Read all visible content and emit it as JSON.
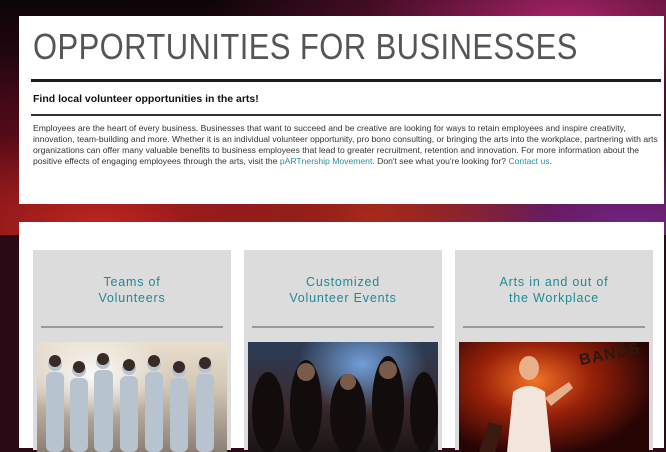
{
  "header": {
    "title": "OPPORTUNITIES FOR BUSINESSES",
    "subtitle": "Find local volunteer opportunities in the arts!",
    "body_text": "Employees are the heart of every business. Businesses that want to succeed and be creative are looking for ways to retain employees and inspire creativity, innovation, team-building and more.  Whether it is an individual volunteer opportunity, pro bono consulting, or bringing the arts into the workplace, partnering with arts organizations can offer many valuable benefits to business employees that lead to greater recruitment, retention and innovation. For more information about the positive effects of engaging employees through the arts, visit the ",
    "partnership_link": "pARTnership Movement",
    "after_link_text": ". Don't see what you're looking for? ",
    "contact_link": "Contact us",
    "end_text": "."
  },
  "cards": [
    {
      "title_line1": "Teams of",
      "title_line2": "Volunteers"
    },
    {
      "title_line1": "Customized",
      "title_line2": "Volunteer Events"
    },
    {
      "title_line1": "Arts in and out of",
      "title_line2": "the Workplace",
      "photo_sign": "BANDS"
    }
  ],
  "colors": {
    "accent": "#1e8a96",
    "link": "#2e8b9a",
    "card_bg": "#dcdcdc"
  }
}
